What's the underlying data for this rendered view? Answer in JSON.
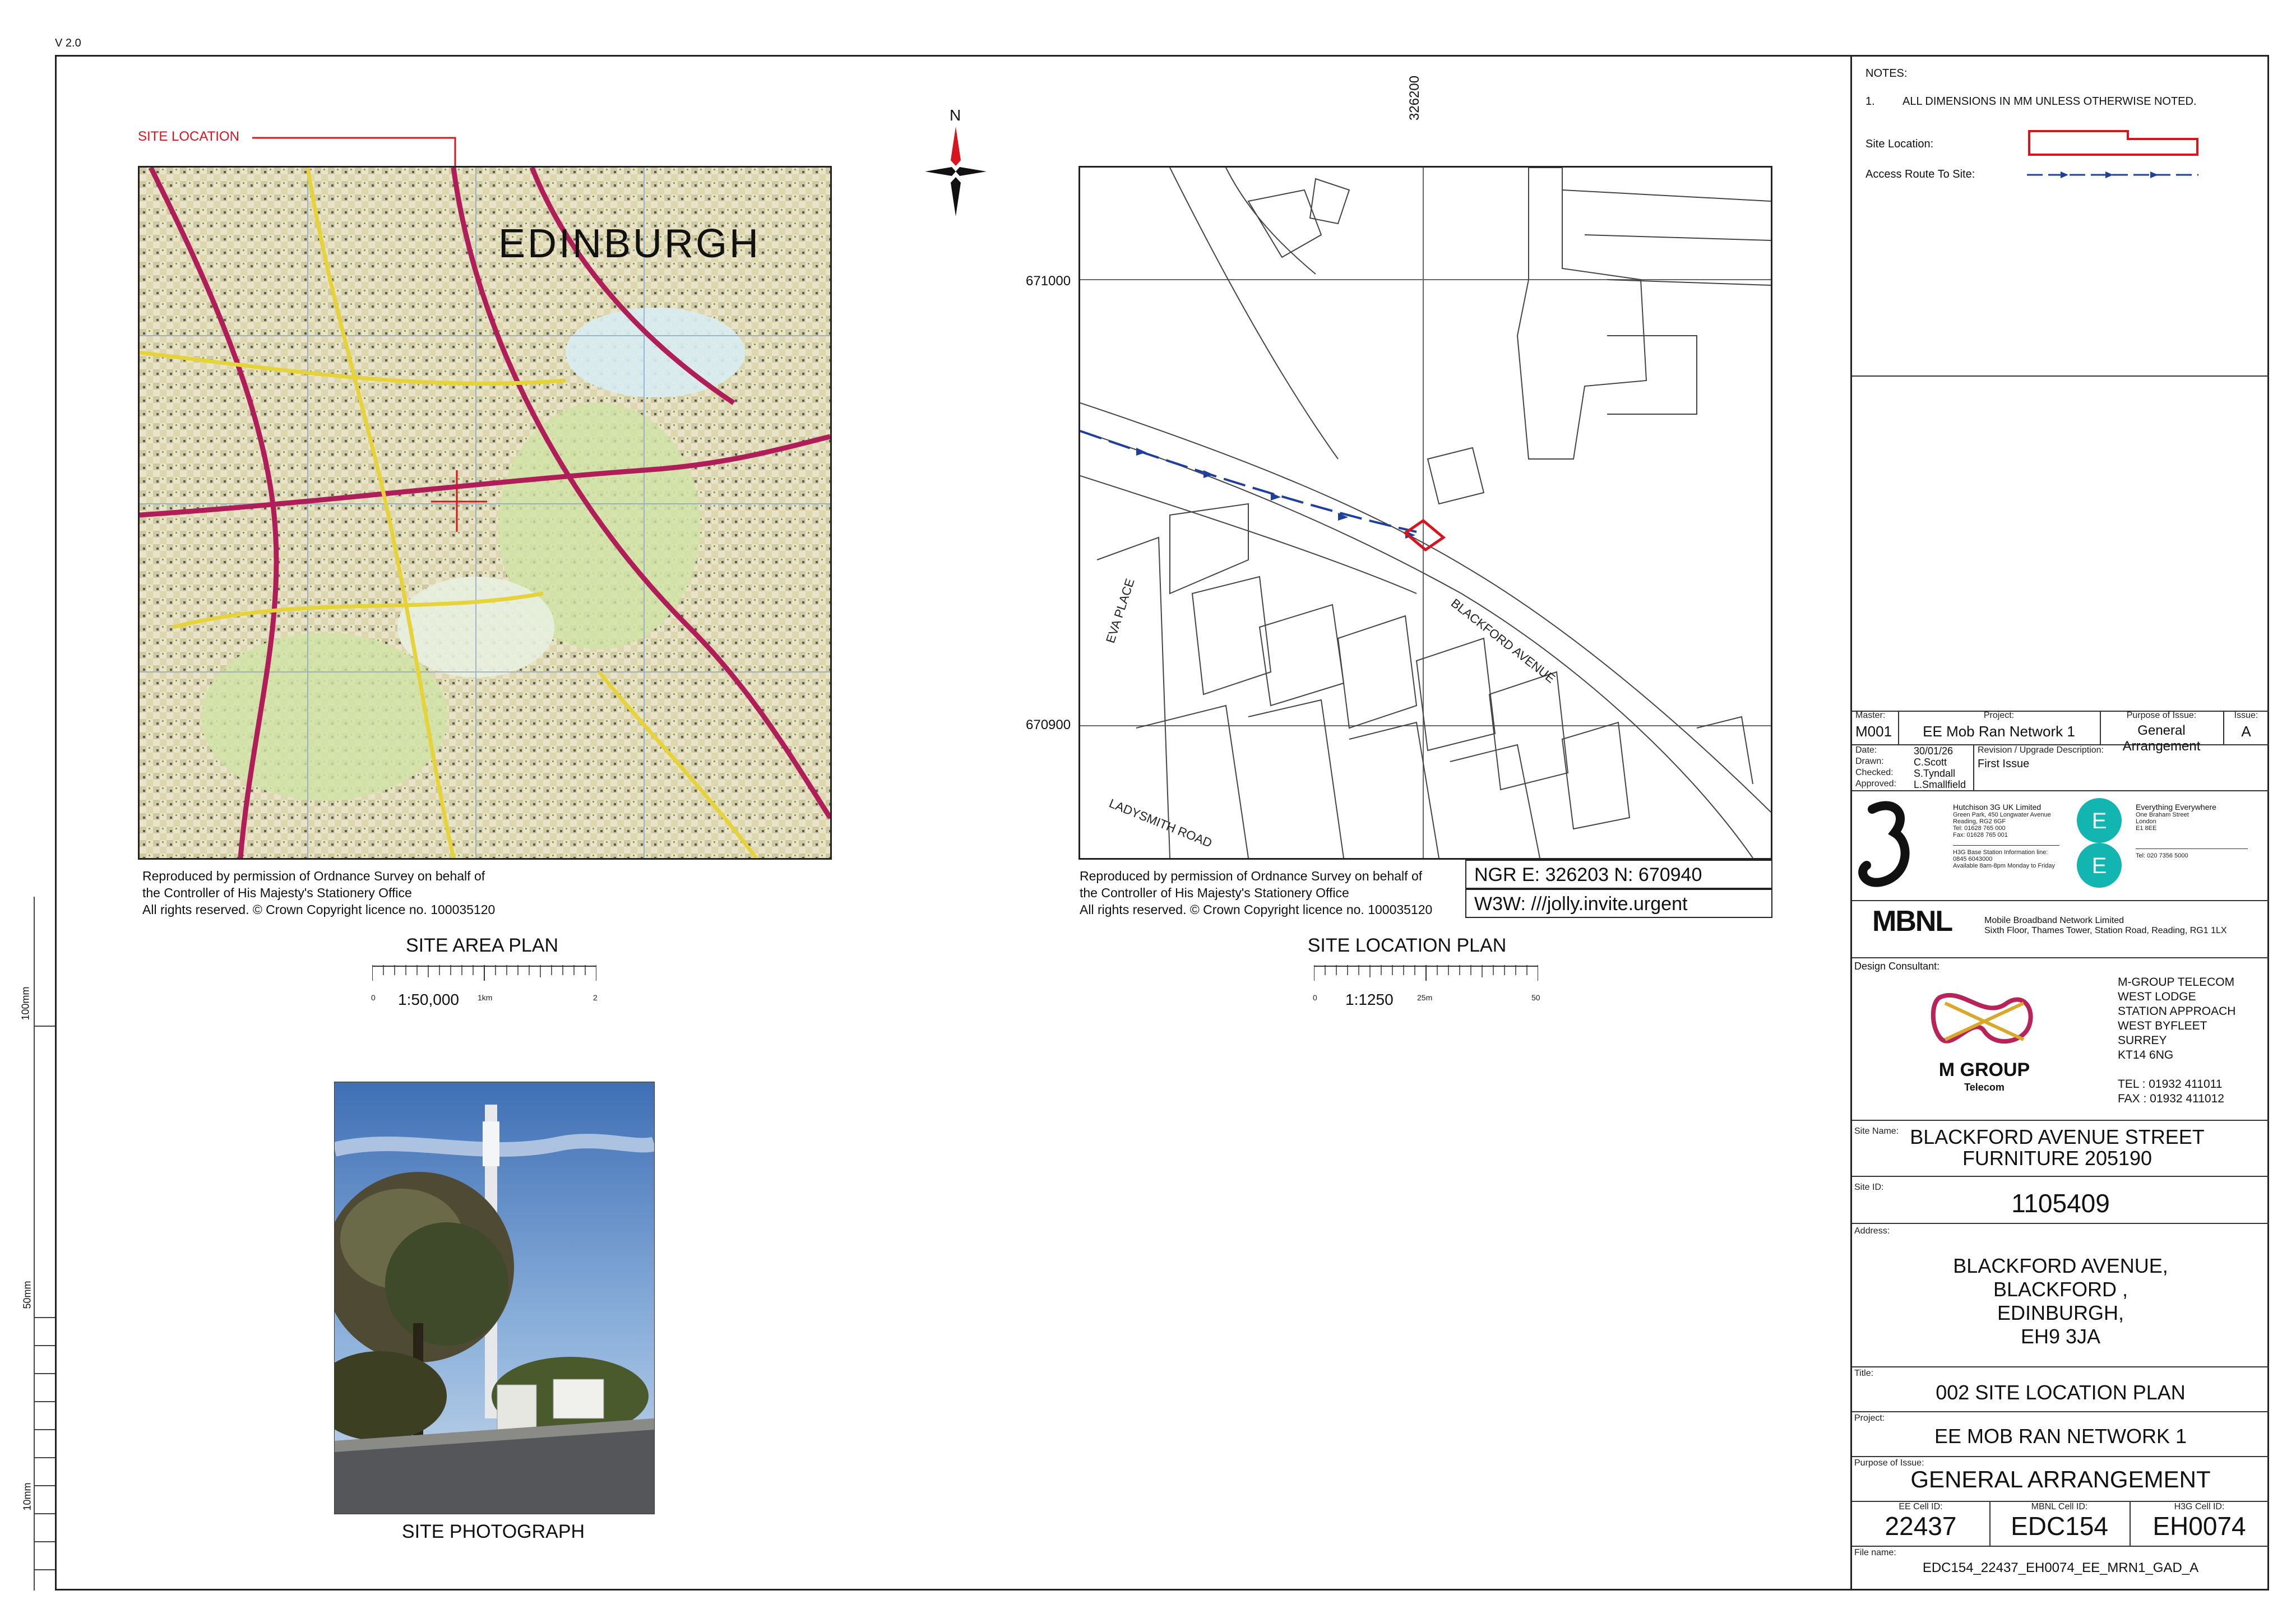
{
  "version": "V 2.0",
  "notes": {
    "heading": "NOTES:",
    "item_num": "1.",
    "item_text": "ALL DIMENSIONS IN MM UNLESS OTHERWISE NOTED.",
    "site_location_label": "Site Location:",
    "access_route_label": "Access Route To Site:"
  },
  "site_area_plan": {
    "pointer_label": "SITE LOCATION",
    "map_text": "EDINBURGH",
    "title": "SITE AREA PLAN",
    "scale": "1:50,000",
    "ruler_start": "0",
    "ruler_mid": "1km",
    "ruler_end": "2",
    "copyright": [
      "Reproduced by permission of Ordnance Survey on behalf of",
      "the Controller of His Majesty's Stationery Office",
      "All rights reserved. © Crown Copyright licence no. 100035120"
    ]
  },
  "site_location_plan": {
    "north": "N",
    "easting_label": "326200",
    "northing_top": "671000",
    "northing_bottom": "670900",
    "road_blackford": "BLACKFORD AVENUE",
    "road_eva": "EVA PLACE",
    "road_ladysmith": "LADYSMITH ROAD",
    "ngr": "NGR  E: 326203  N: 670940",
    "w3w": "W3W: ///jolly.invite.urgent",
    "title": "SITE LOCATION PLAN",
    "scale": "1:1250",
    "ruler_start": "0",
    "ruler_mid": "25m",
    "ruler_end": "50",
    "copyright": [
      "Reproduced by permission of Ordnance Survey on behalf of",
      "the Controller of His Majesty's Stationery Office",
      "All rights reserved. © Crown Copyright licence no. 100035120"
    ]
  },
  "photo": {
    "title": "SITE PHOTOGRAPH"
  },
  "side_scale": {
    "mark_100": "100mm",
    "mark_50": "50mm",
    "mark_10": "10mm"
  },
  "title_block": {
    "master_label": "Master:",
    "master": "M001",
    "project_label": "Project:",
    "project": "EE Mob Ran Network 1",
    "purpose_label": "Purpose of Issue:",
    "purpose": "General Arrangement",
    "issue_label": "Issue:",
    "issue": "A",
    "date_label": "Date:",
    "date": "30/01/26",
    "drawn_label": "Drawn:",
    "drawn": "C.Scott",
    "checked_label": "Checked:",
    "checked": "S.Tyndall",
    "approved_label": "Approved:",
    "approved": "L.Smallfield",
    "revision_label": "Revision / Upgrade Description:",
    "revision": "First Issue",
    "h3g": {
      "name": "Hutchison 3G UK Limited",
      "lines": [
        "Green Park, 450 Longwater Avenue",
        "Reading, RG2 6GF",
        "Tel: 01628 765 000",
        "Fax: 01628 765 001",
        "H3G Base Station Information line:",
        "0845 6043000",
        "Available 8am-8pm Monday to Friday"
      ]
    },
    "ee": {
      "name": "Everything Everywhere",
      "lines": [
        "One Braham Street",
        "London",
        "E1 8EE",
        "Tel: 020 7356 5000"
      ]
    },
    "mbnl": {
      "logo": "MBNL",
      "name": "Mobile Broadband Network Limited",
      "address": "Sixth Floor, Thames Tower,  Station Road, Reading, RG1 1LX"
    },
    "design_consultant_label": "Design Consultant:",
    "mgroup": {
      "logo_text": "M GROUP",
      "logo_sub": "Telecom",
      "address": [
        "M-GROUP TELECOM",
        "WEST LODGE",
        "STATION APPROACH",
        "WEST BYFLEET",
        "SURREY",
        "KT14 6NG"
      ],
      "tel": "TEL : 01932 411011",
      "fax": "FAX : 01932 411012"
    },
    "site_name_label": "Site Name:",
    "site_name": [
      "BLACKFORD AVENUE STREET",
      "FURNITURE 205190"
    ],
    "site_id_label": "Site ID:",
    "site_id": "1105409",
    "address_label": "Address:",
    "address": [
      "BLACKFORD AVENUE,",
      "BLACKFORD ,",
      "EDINBURGH,",
      "EH9 3JA"
    ],
    "title_label": "Title:",
    "title": "002 SITE LOCATION PLAN",
    "project2_label": "Project:",
    "project2": "EE MOB RAN NETWORK 1",
    "purpose2_label": "Purpose of Issue:",
    "purpose2": "GENERAL ARRANGEMENT",
    "ee_cell_label": "EE Cell ID:",
    "ee_cell": "22437",
    "mbnl_cell_label": "MBNL Cell ID:",
    "mbnl_cell": "EDC154",
    "h3g_cell_label": "H3G Cell ID:",
    "h3g_cell": "EH0074",
    "file_label": "File name:",
    "file": "EDC154_22437_EH0074_EE_MRN1_GAD_A"
  },
  "colors": {
    "site_red": "#d8141e",
    "route_blue": "#1f3f9e",
    "ee_teal": "#12b5b0",
    "mgroup_magenta": "#b8235a",
    "mgroup_gold": "#d9a82a"
  }
}
